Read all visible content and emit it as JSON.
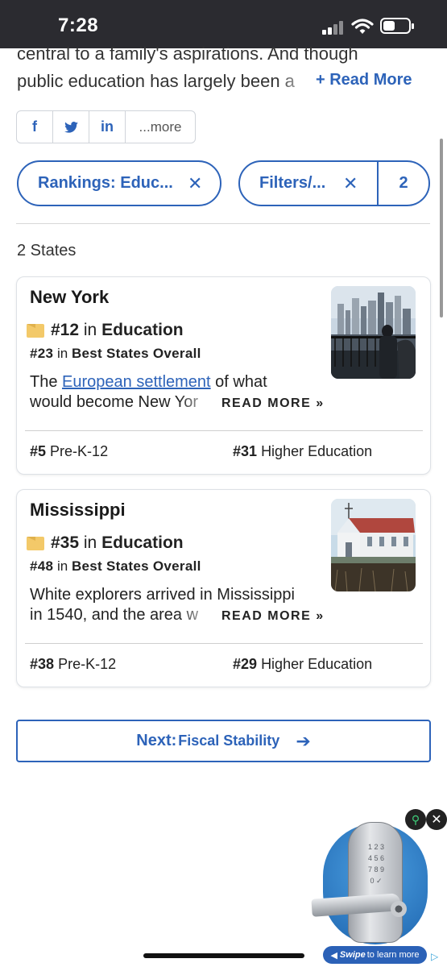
{
  "status_bar": {
    "time": "7:28",
    "battery_level": 0.45
  },
  "intro": {
    "line1": "central to a family's aspirations. And though",
    "line2": "public education has largely been a",
    "read_more": "+ Read More"
  },
  "share": {
    "more_label": "...more"
  },
  "filters": [
    {
      "label": "Rankings: Educ...",
      "close": "✕"
    },
    {
      "label": "Filters/...",
      "close": "✕",
      "count": "2"
    }
  ],
  "results_count": "2 States",
  "states": [
    {
      "name": "New York",
      "rank": "#12",
      "rank_in": "in",
      "category": "Education",
      "overall_rank": "#23",
      "overall_in": "in",
      "overall_label": "Best States Overall",
      "desc_before": "The ",
      "desc_link": "European settlement",
      "desc_after": " of what",
      "desc_line2": "would become New Yor",
      "read_more": "READ MORE »",
      "prek_rank": "#5",
      "prek_label": "Pre-K-12",
      "higher_rank": "#31",
      "higher_label": "Higher Education"
    },
    {
      "name": "Mississippi",
      "rank": "#35",
      "rank_in": "in",
      "category": "Education",
      "overall_rank": "#48",
      "overall_in": "in",
      "overall_label": "Best States Overall",
      "desc_line1": "White explorers arrived in Mississippi",
      "desc_line2": "in 1540, and the area w",
      "read_more": "READ MORE »",
      "prek_rank": "#38",
      "prek_label": "Pre-K-12",
      "higher_rank": "#29",
      "higher_label": "Higher Education"
    }
  ],
  "next": {
    "label": "Next:",
    "sub": "Fiscal Stability",
    "arrow": "➔"
  },
  "ad": {
    "swipe_bold": "Swipe",
    "swipe_text": "to learn more",
    "keypad": "1 2 3\n4 5 6\n7 8 9\n0 ✓",
    "close": "✕"
  },
  "colors": {
    "accent": "#2d63b9",
    "status_bar": "#2b2b30",
    "rank_icon": "#f3c969"
  }
}
